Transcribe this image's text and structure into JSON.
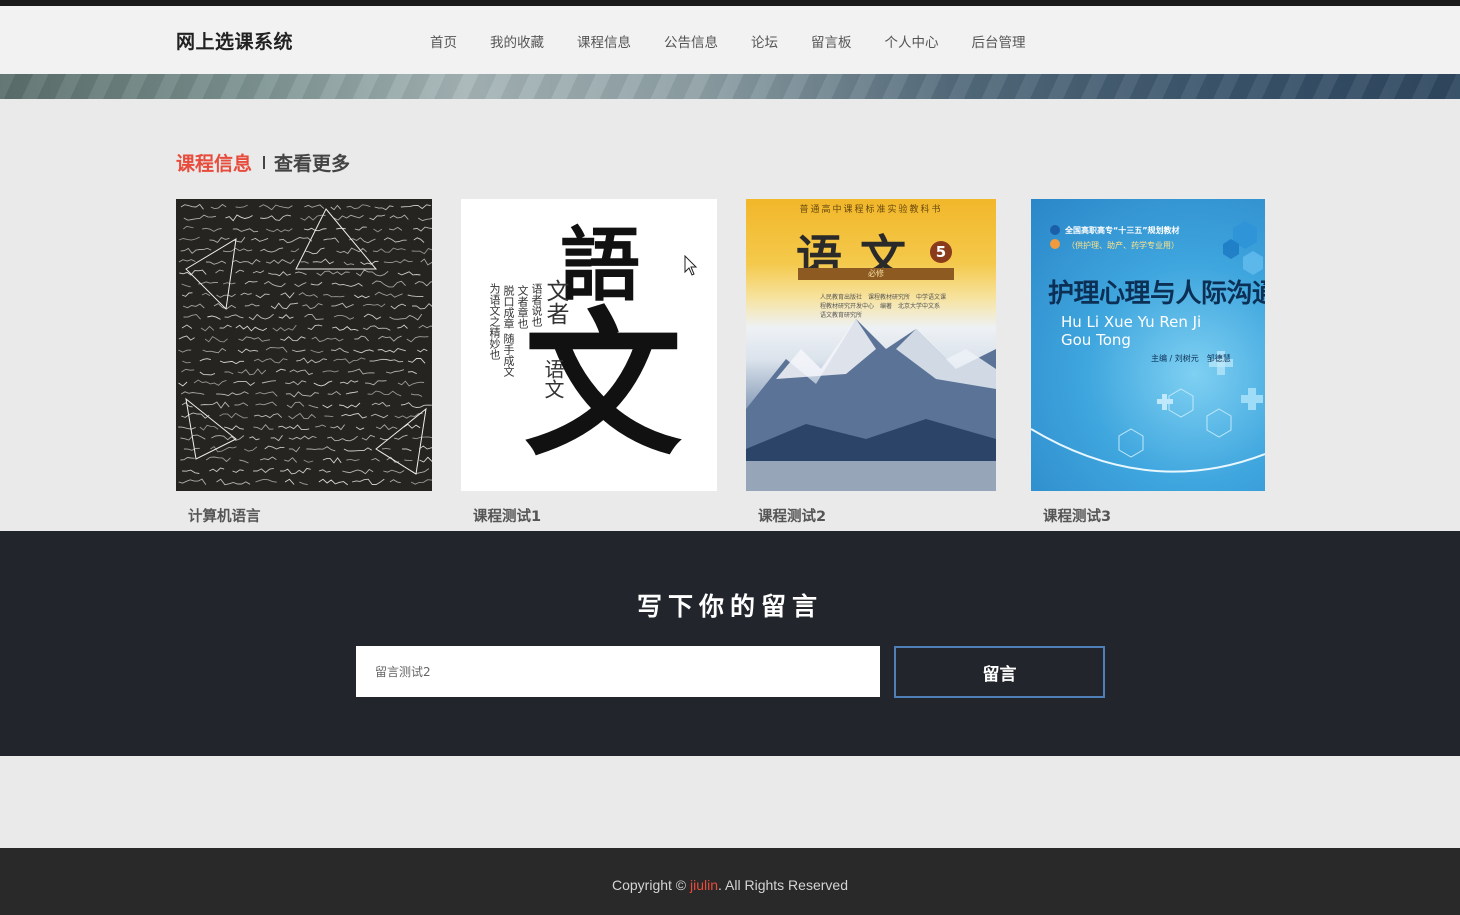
{
  "header": {
    "brand": "网上选课系统",
    "nav": [
      "首页",
      "我的收藏",
      "课程信息",
      "公告信息",
      "论坛",
      "留言板",
      "个人中心",
      "后台管理"
    ]
  },
  "section": {
    "title": "课程信息",
    "more": "查看更多"
  },
  "courses": [
    {
      "name": "计算机语言",
      "image": "chalkboard-math-image"
    },
    {
      "name": "课程测试1",
      "image": "calligraphy-yuwen-image"
    },
    {
      "name": "课程测试2",
      "image": "yuwen-textbook-cover-image"
    },
    {
      "name": "课程测试3",
      "image": "nursing-textbook-cover-image"
    }
  ],
  "calligraphy": {
    "big1": "語",
    "big2": "文",
    "col1": "文者",
    "col2": "语者说也",
    "col3": "文者章也",
    "col4": "脱口成章",
    "col5": "随手成文",
    "col6": "为语文之精妙也",
    "mid": "语文"
  },
  "textbook": {
    "series": "普通高中课程标准实验教科书",
    "title": "语文",
    "volume": "5",
    "tag": "必修",
    "publisher": "人民教育出版社　课程教材研究所　中学语文课程教材研究开发中心　编著　北京大学中文系　语文教育研究所"
  },
  "nursing": {
    "tag": "全国高职高专“十三五”规划教材",
    "sub": "（供护理、助产、药学专业用）",
    "title": "护理心理与人际沟通",
    "pinyin1": "Hu Li Xue Yu Ren Ji",
    "pinyin2": "Gou Tong",
    "editor": "主编 / 刘树元　邹德慧"
  },
  "message": {
    "title": "写下你的留言",
    "input_value": "留言测试2",
    "button": "留言"
  },
  "footer": {
    "prefix": "Copyright © ",
    "brand": "jiulin",
    "suffix": ". All Rights Reserved"
  },
  "colors": {
    "accent": "#e74c3c",
    "dark": "#22262c",
    "button_border": "#4f7fb6"
  }
}
